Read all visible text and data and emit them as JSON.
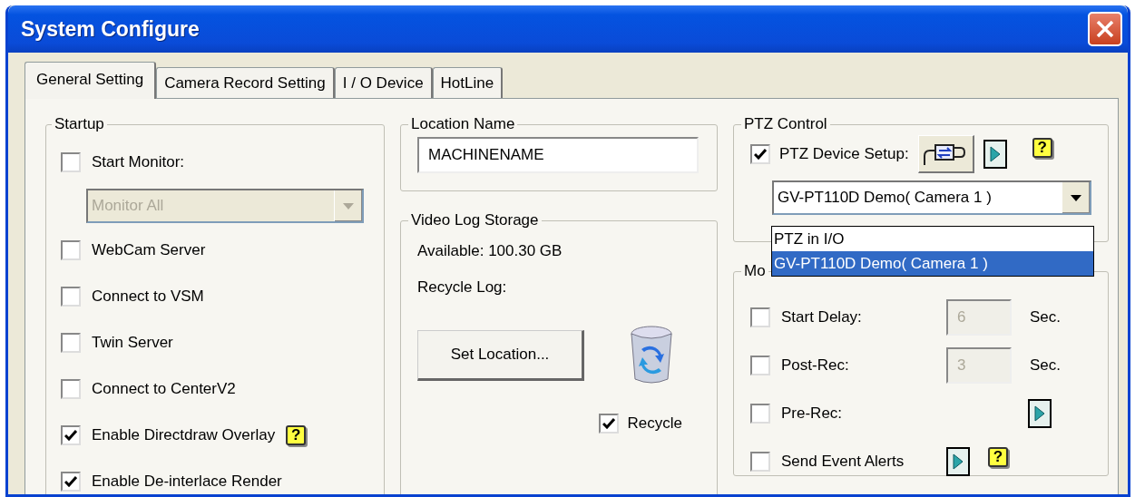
{
  "window": {
    "title": "System Configure"
  },
  "tabs": [
    {
      "label": "General Setting",
      "selected": true
    },
    {
      "label": "Camera Record Setting",
      "selected": false
    },
    {
      "label": "I / O Device",
      "selected": false
    },
    {
      "label": "HotLine",
      "selected": false
    }
  ],
  "startup": {
    "title": "Startup",
    "items": [
      {
        "kind": "checkbox",
        "label": "Start Monitor:",
        "checked": false
      },
      {
        "kind": "select",
        "value": "Monitor All",
        "disabled": true
      },
      {
        "kind": "checkbox",
        "label": "WebCam Server",
        "checked": false
      },
      {
        "kind": "checkbox",
        "label": "Connect to VSM",
        "checked": false
      },
      {
        "kind": "checkbox",
        "label": "Twin Server",
        "checked": false
      },
      {
        "kind": "checkbox",
        "label": "Connect to CenterV2",
        "checked": false
      },
      {
        "kind": "checkbox",
        "label": "Enable Directdraw Overlay",
        "checked": true,
        "help": "?"
      },
      {
        "kind": "checkbox",
        "label": "Enable De-interlace Render",
        "checked": true
      }
    ]
  },
  "location": {
    "title": "Location Name",
    "value": "MACHINENAME"
  },
  "storage": {
    "title": "Video Log Storage",
    "available": "Available: 100.30 GB",
    "recycle_log": "Recycle Log:",
    "button": "Set Location...",
    "recycle": {
      "label": "Recycle",
      "checked": true
    }
  },
  "ptz": {
    "title": "PTZ Control",
    "device_setup": {
      "label": "PTZ Device Setup:",
      "checked": true,
      "help": "?"
    },
    "select": {
      "value": "GV-PT110D Demo( Camera 1 )"
    },
    "dropdown": {
      "options": [
        {
          "label": "PTZ in I/O",
          "selected": false
        },
        {
          "label": "GV-PT110D Demo( Camera 1 )",
          "selected": true
        }
      ]
    }
  },
  "motion": {
    "title": "Mo",
    "rows": [
      {
        "kind": "delay",
        "label": "Start Delay:",
        "checked": false,
        "value": "6",
        "unit": "Sec.",
        "disabled": true
      },
      {
        "kind": "delay",
        "label": "Post-Rec:",
        "checked": false,
        "value": "3",
        "unit": "Sec.",
        "disabled": true
      },
      {
        "kind": "arrow",
        "label": "Pre-Rec:",
        "checked": false
      },
      {
        "kind": "arrow",
        "label": "Send Event Alerts",
        "checked": false,
        "help": "?"
      }
    ]
  }
}
